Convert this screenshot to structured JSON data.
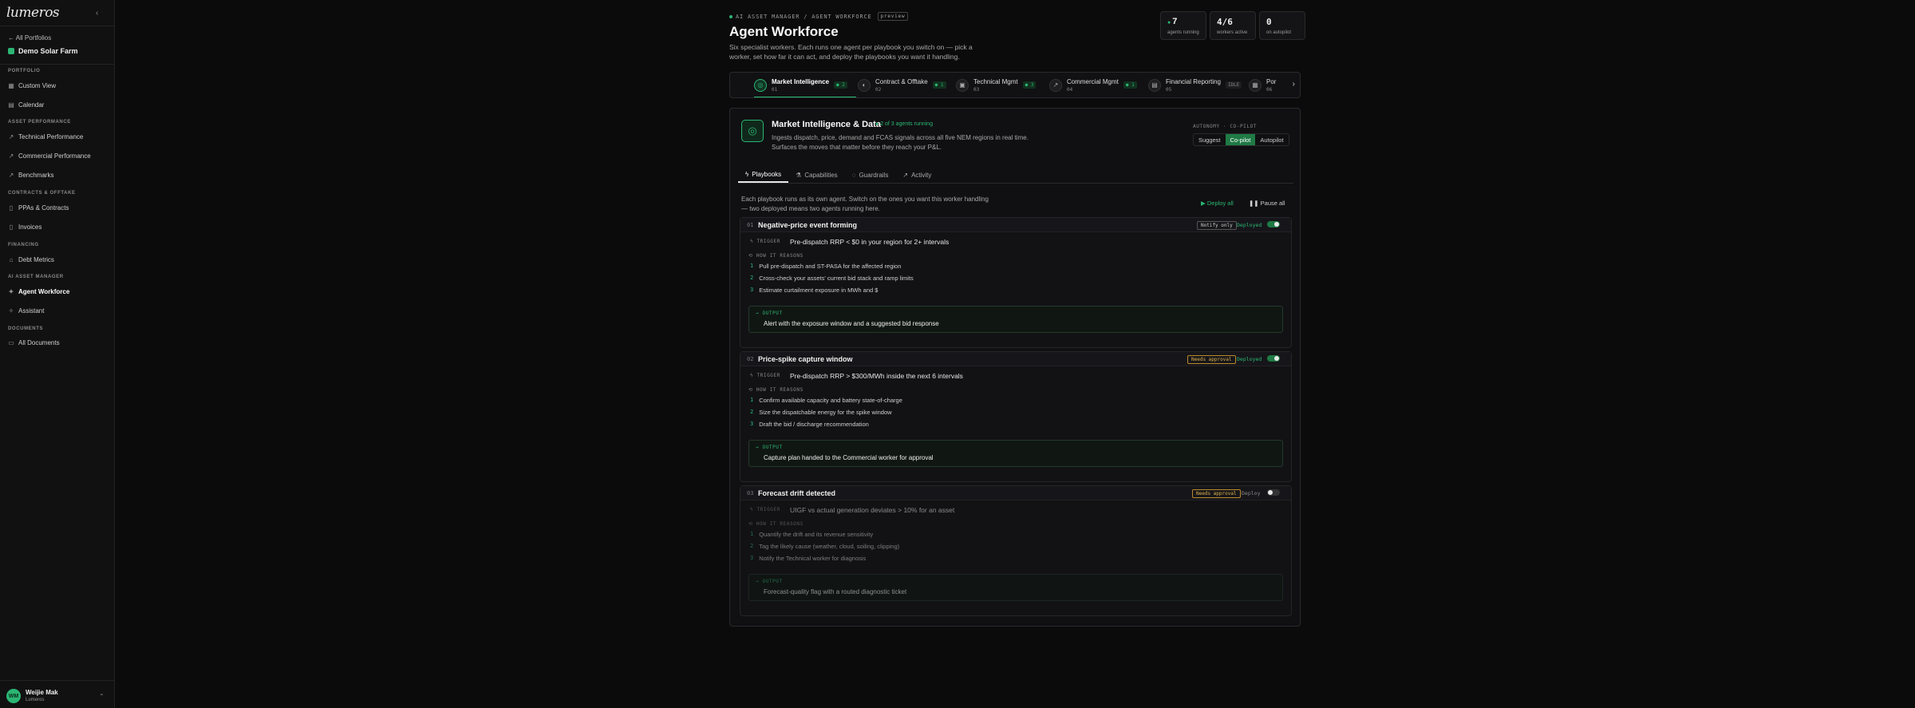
{
  "sidebar": {
    "logo": "lumeros",
    "back_label": "All Portfolios",
    "farm": "Demo Solar Farm",
    "sections": {
      "portfolio": "PORTFOLIO",
      "asset": "ASSET PERFORMANCE",
      "contracts": "CONTRACTS & OFFTAKE",
      "financing": "FINANCING",
      "ai": "AI ASSET MANAGER",
      "documents": "DOCUMENTS"
    },
    "items": [
      {
        "label": "Custom View"
      },
      {
        "label": "Calendar"
      },
      {
        "label": "Technical Performance"
      },
      {
        "label": "Commercial Performance"
      },
      {
        "label": "Benchmarks"
      },
      {
        "label": "PPAs & Contracts"
      },
      {
        "label": "Invoices"
      },
      {
        "label": "Debt Metrics"
      },
      {
        "label": "Agent Workforce"
      },
      {
        "label": "Assistant"
      },
      {
        "label": "All Documents"
      }
    ],
    "user": {
      "initials": "WM",
      "name": "Weijie Mak",
      "org": "Lumeros"
    }
  },
  "header": {
    "breadcrumb": "AI ASSET MANAGER / AGENT WORKFORCE",
    "preview_badge": "preview",
    "title": "Agent Workforce",
    "subtitle": "Six specialist workers. Each runs one agent per playbook you switch on — pick a worker, set how far it can act, and deploy the playbooks you want it handling."
  },
  "stats": [
    {
      "value": "7",
      "label": "agents running"
    },
    {
      "value": "4/6",
      "label": "workers active"
    },
    {
      "value": "0",
      "label": "on autopilot"
    }
  ],
  "worker_tabs": [
    {
      "name": "Market Intelligence",
      "code": "01",
      "badge": "2"
    },
    {
      "name": "Contract & Offtake",
      "code": "02",
      "badge": "1"
    },
    {
      "name": "Technical Mgmt",
      "code": "03",
      "badge": "3"
    },
    {
      "name": "Commercial Mgmt",
      "code": "04",
      "badge": "1"
    },
    {
      "name": "Financial Reporting",
      "code": "05",
      "badge": "IDLE"
    },
    {
      "name": "Por",
      "code": "06",
      "badge": ""
    }
  ],
  "worker": {
    "title": "Market Intelligence & Data",
    "running": "2 of 3 agents running",
    "description": "Ingests dispatch, price, demand and FCAS signals across all five NEM regions in real time. Surfaces the moves that matter before they reach your P&L.",
    "autonomy_label": "AUTONOMY · CO-PILOT",
    "autonomy_options": [
      "Suggest",
      "Co-pilot",
      "Autopilot"
    ],
    "autonomy_selected": "Co-pilot"
  },
  "panel_tabs": [
    "Playbooks",
    "Capabilities",
    "Guardrails",
    "Activity"
  ],
  "playbooks_intro": "Each playbook runs as its own agent. Switch on the ones you want this worker handling — two deployed means two agents running here.",
  "actions": {
    "deploy_all": "Deploy all",
    "pause_all": "Pause all"
  },
  "labels": {
    "trigger": "TRIGGER",
    "reasons": "HOW IT REASONS",
    "output": "OUTPUT"
  },
  "playbooks": [
    {
      "num": "01",
      "title": "Negative-price event forming",
      "mode": "Notify only",
      "status": "Deployed",
      "trigger": "Pre-dispatch RRP < $0 in your region for 2+ intervals",
      "steps": [
        "Pull pre-dispatch and ST-PASA for the affected region",
        "Cross-check your assets' current bid stack and ramp limits",
        "Estimate curtailment exposure in MWh and $"
      ],
      "output": "Alert with the exposure window and a suggested bid response"
    },
    {
      "num": "02",
      "title": "Price-spike capture window",
      "mode": "Needs approval",
      "status": "Deployed",
      "trigger": "Pre-dispatch RRP > $300/MWh inside the next 6 intervals",
      "steps": [
        "Confirm available capacity and battery state-of-charge",
        "Size the dispatchable energy for the spike window",
        "Draft the bid / discharge recommendation"
      ],
      "output": "Capture plan handed to the Commercial worker for approval"
    },
    {
      "num": "03",
      "title": "Forecast drift detected",
      "mode": "Needs approval",
      "status": "Deploy",
      "trigger": "UIGF vs actual generation deviates > 10% for an asset",
      "steps": [
        "Quantify the drift and its revenue sensitivity",
        "Tag the likely cause (weather, cloud, soiling, clipping)",
        "Notify the Technical worker for diagnosis"
      ],
      "output": "Forecast-quality flag with a routed diagnostic ticket"
    }
  ],
  "colors": {
    "accent": "#2bb673",
    "approval": "#e0b24a"
  }
}
